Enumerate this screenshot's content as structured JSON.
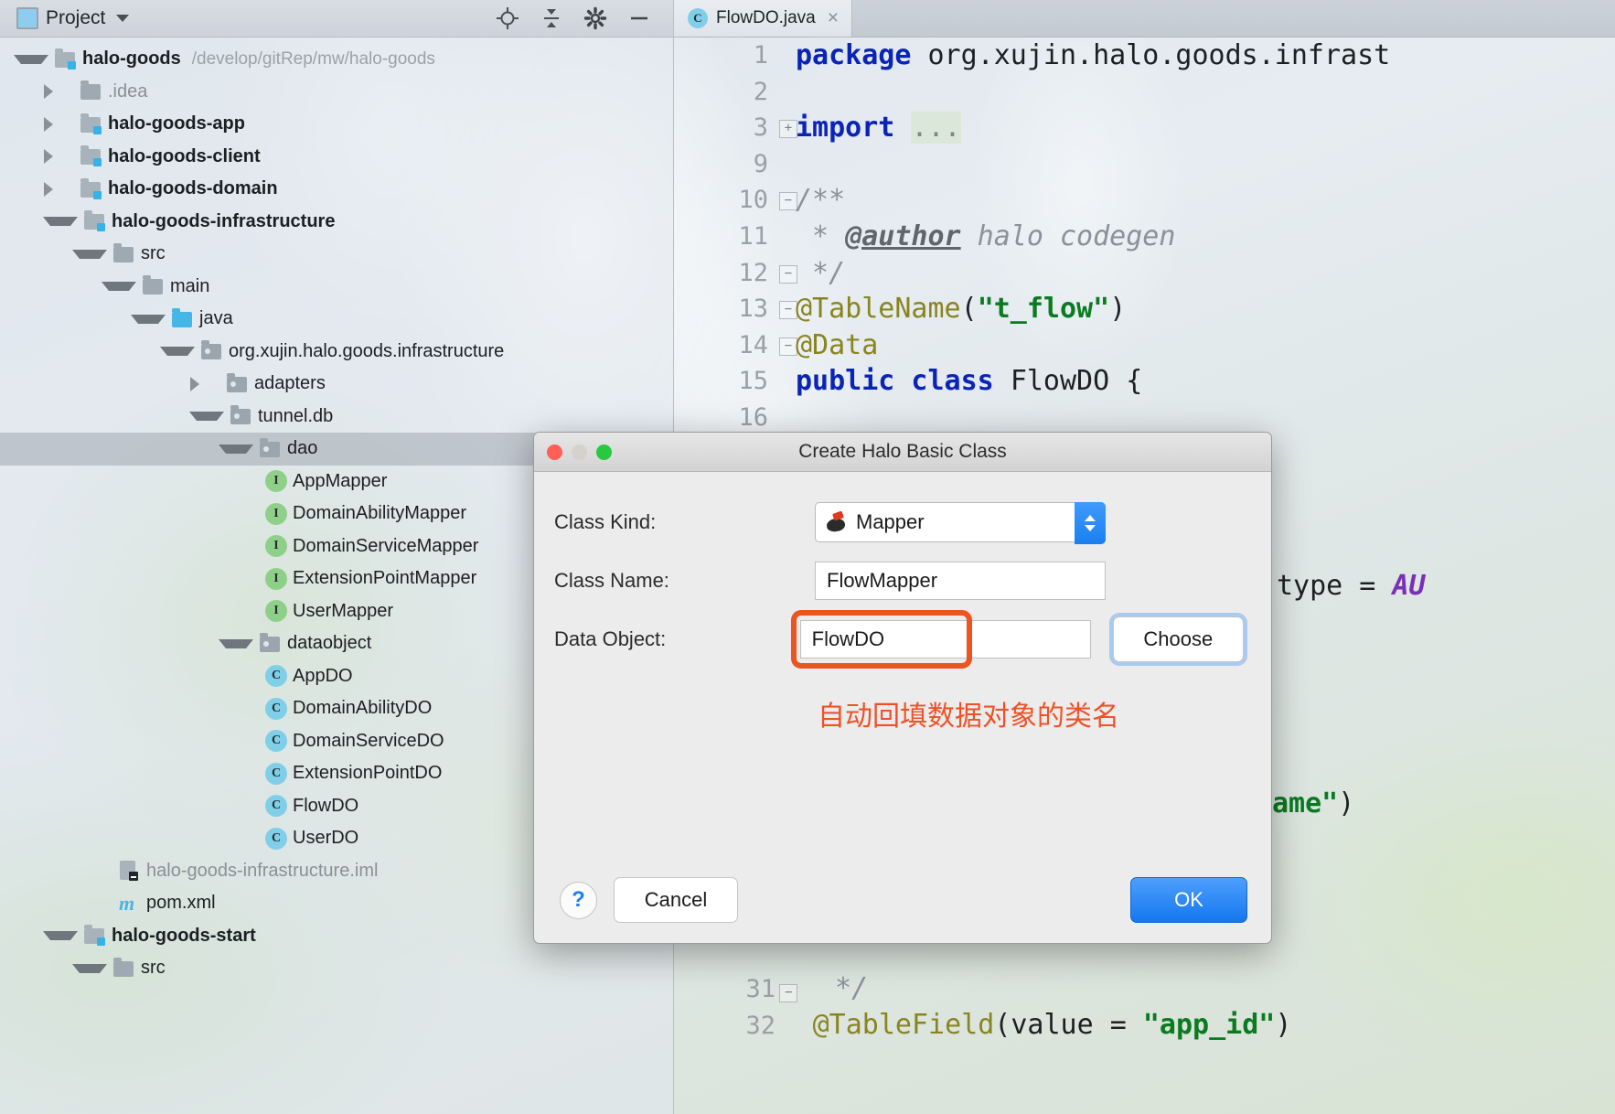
{
  "project_panel": {
    "header": {
      "title": "Project",
      "icons": [
        "locate-icon",
        "collapse-all-icon",
        "gear-icon",
        "minimize-icon"
      ]
    },
    "tree": [
      {
        "depth": 0,
        "twisty": "down",
        "icon": "module-folder-icon",
        "label": "halo-goods",
        "bold": true,
        "path": "/develop/gitRep/mw/halo-goods"
      },
      {
        "depth": 1,
        "twisty": "right",
        "icon": "folder-icon",
        "label": ".idea",
        "dim": true
      },
      {
        "depth": 1,
        "twisty": "right",
        "icon": "module-folder-icon",
        "label": "halo-goods-app",
        "bold": true
      },
      {
        "depth": 1,
        "twisty": "right",
        "icon": "module-folder-icon",
        "label": "halo-goods-client",
        "bold": true
      },
      {
        "depth": 1,
        "twisty": "right",
        "icon": "module-folder-icon",
        "label": "halo-goods-domain",
        "bold": true
      },
      {
        "depth": 1,
        "twisty": "down",
        "icon": "module-folder-icon",
        "label": "halo-goods-infrastructure",
        "bold": true
      },
      {
        "depth": 2,
        "twisty": "down",
        "icon": "folder-icon",
        "label": "src"
      },
      {
        "depth": 3,
        "twisty": "down",
        "icon": "folder-icon",
        "label": "main"
      },
      {
        "depth": 4,
        "twisty": "down",
        "icon": "source-folder-icon",
        "label": "java"
      },
      {
        "depth": 5,
        "twisty": "down",
        "icon": "package-icon",
        "label": "org.xujin.halo.goods.infrastructure"
      },
      {
        "depth": 6,
        "twisty": "right",
        "icon": "package-icon",
        "label": "adapters"
      },
      {
        "depth": 6,
        "twisty": "down",
        "icon": "package-icon",
        "label": "tunnel.db"
      },
      {
        "depth": 7,
        "twisty": "down",
        "icon": "package-icon",
        "label": "dao",
        "selected": true
      },
      {
        "depth": 8,
        "twisty": "none",
        "icon": "interface-icon",
        "label": "AppMapper"
      },
      {
        "depth": 8,
        "twisty": "none",
        "icon": "interface-icon",
        "label": "DomainAbilityMapper"
      },
      {
        "depth": 8,
        "twisty": "none",
        "icon": "interface-icon",
        "label": "DomainServiceMapper"
      },
      {
        "depth": 8,
        "twisty": "none",
        "icon": "interface-icon",
        "label": "ExtensionPointMapper"
      },
      {
        "depth": 8,
        "twisty": "none",
        "icon": "interface-icon",
        "label": "UserMapper"
      },
      {
        "depth": 7,
        "twisty": "down",
        "icon": "package-icon",
        "label": "dataobject"
      },
      {
        "depth": 8,
        "twisty": "none",
        "icon": "class-icon",
        "label": "AppDO"
      },
      {
        "depth": 8,
        "twisty": "none",
        "icon": "class-icon",
        "label": "DomainAbilityDO"
      },
      {
        "depth": 8,
        "twisty": "none",
        "icon": "class-icon",
        "label": "DomainServiceDO"
      },
      {
        "depth": 8,
        "twisty": "none",
        "icon": "class-icon",
        "label": "ExtensionPointDO"
      },
      {
        "depth": 8,
        "twisty": "none",
        "icon": "class-icon",
        "label": "FlowDO"
      },
      {
        "depth": 8,
        "twisty": "none",
        "icon": "class-icon",
        "label": "UserDO"
      },
      {
        "depth": 3,
        "twisty": "none",
        "icon": "iml-file-icon",
        "label": "halo-goods-infrastructure.iml",
        "dim": true
      },
      {
        "depth": 3,
        "twisty": "none",
        "icon": "maven-file-icon",
        "label": "pom.xml"
      },
      {
        "depth": 1,
        "twisty": "down",
        "icon": "module-folder-icon",
        "label": "halo-goods-start",
        "bold": true
      },
      {
        "depth": 2,
        "twisty": "down",
        "icon": "folder-icon",
        "label": "src"
      }
    ]
  },
  "editor": {
    "tab": {
      "label": "FlowDO.java",
      "icon": "class-icon",
      "close": "×"
    },
    "lines": [
      {
        "num": "1",
        "fold": "",
        "segments": [
          {
            "t": "package ",
            "c": "kw"
          },
          {
            "t": "org.xujin.halo.goods.infrast",
            "c": "plain"
          }
        ]
      },
      {
        "num": "2",
        "fold": "",
        "segments": []
      },
      {
        "num": "3",
        "fold": "+",
        "segments": [
          {
            "t": "import ",
            "c": "kw"
          },
          {
            "t": "...",
            "c": "elip"
          }
        ]
      },
      {
        "num": "9",
        "fold": "",
        "segments": []
      },
      {
        "num": "10",
        "fold": "-",
        "segments": [
          {
            "t": "/**",
            "c": "cmt"
          }
        ]
      },
      {
        "num": "11",
        "fold": "",
        "segments": [
          {
            "t": " * ",
            "c": "cmt"
          },
          {
            "t": "@author",
            "c": "cmt-tag"
          },
          {
            "t": " halo codegen",
            "c": "cmt"
          }
        ]
      },
      {
        "num": "12",
        "fold": "-",
        "segments": [
          {
            "t": " */",
            "c": "cmt"
          }
        ]
      },
      {
        "num": "13",
        "fold": "-",
        "segments": [
          {
            "t": "@TableName",
            "c": "ann"
          },
          {
            "t": "(",
            "c": "plain"
          },
          {
            "t": "\"t_flow\"",
            "c": "str"
          },
          {
            "t": ")",
            "c": "plain"
          }
        ]
      },
      {
        "num": "14",
        "fold": "-",
        "segments": [
          {
            "t": "@Data",
            "c": "ann"
          }
        ]
      },
      {
        "num": "15",
        "fold": "",
        "segments": [
          {
            "t": "public class ",
            "c": "kw"
          },
          {
            "t": "FlowDO {",
            "c": "plain"
          }
        ]
      },
      {
        "num": "16",
        "fold": "",
        "segments": []
      }
    ],
    "lines_behind": [
      {
        "num": "",
        "segments": [
          {
            "t": "type = AU",
            "c": "purple"
          }
        ]
      },
      {
        "num": "",
        "segments": [
          {
            "t": "ame\")",
            "c": "teal"
          }
        ]
      },
      {
        "num": "31",
        "segments": [
          {
            "t": " */",
            "c": "cmt"
          }
        ]
      },
      {
        "num": "32",
        "segments": [
          {
            "t": "@TableField(value = \"app_id\")",
            "c": "ann"
          }
        ]
      }
    ]
  },
  "dialog": {
    "title": "Create Halo Basic Class",
    "window_controls": [
      "close-icon",
      "minimize-icon",
      "zoom-icon"
    ],
    "fields": {
      "class_kind": {
        "label": "Class Kind:",
        "value": "Mapper",
        "icon": "mapper-icon"
      },
      "class_name": {
        "label": "Class  Name:",
        "value": "FlowMapper",
        "placeholder": ""
      },
      "data_object": {
        "label": "Data Object:",
        "value": "FlowDO",
        "placeholder": ""
      }
    },
    "choose_button": "Choose",
    "annotation": "自动回填数据对象的类名",
    "help_button": "?",
    "cancel_button": "Cancel",
    "ok_button": "OK",
    "colors": {
      "highlight_ring": "#ec5420",
      "annotation": "#ef5127",
      "accent_blue": "#1577ef",
      "focus_ring": "#a9cbef"
    }
  }
}
